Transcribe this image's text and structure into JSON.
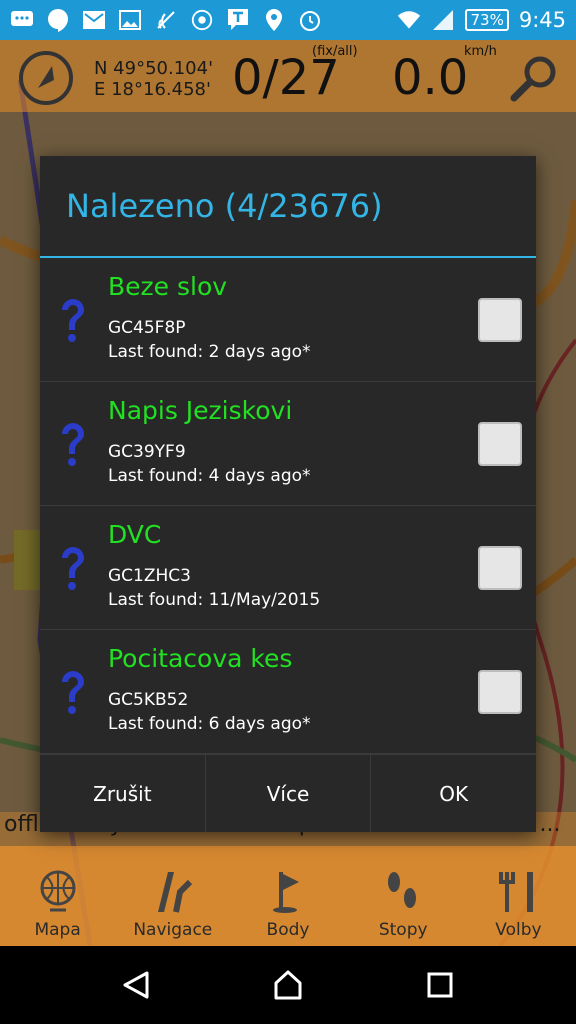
{
  "status_bar": {
    "battery": "73%",
    "time": "9:45"
  },
  "map": {
    "coord_n": "N 49°50.104'",
    "coord_e": "E 18°16.458'",
    "sats": "0/27",
    "sats_unit": "(fix/all)",
    "speed": "0.0",
    "speed_unit": "km/h",
    "offline_text": "offline - Cykloturistická mapa Morava Slovensko ..."
  },
  "bottom_nav": {
    "items": [
      "Mapa",
      "Navigace",
      "Body",
      "Stopy",
      "Volby"
    ]
  },
  "dialog": {
    "title": "Nalezeno (4/23676)",
    "items": [
      {
        "name": "Beze slov",
        "code": "GC45F8P",
        "last_found": "Last found: 2 days ago*"
      },
      {
        "name": "Napis Jeziskovi",
        "code": "GC39YF9",
        "last_found": "Last found: 4 days ago*"
      },
      {
        "name": "DVC",
        "code": "GC1ZHC3",
        "last_found": "Last found: 11/May/2015"
      },
      {
        "name": "Pocitacova kes",
        "code": "GC5KB52",
        "last_found": "Last found: 6 days ago*"
      }
    ],
    "actions": {
      "cancel": "Zrušit",
      "more": "Více",
      "ok": "OK"
    }
  },
  "colors": {
    "status_bar": "#1d9ad6",
    "accent": "#33b5e5",
    "item_name": "#22e022",
    "dialog_bg": "#282828",
    "nav_bg": "#e8902e"
  }
}
